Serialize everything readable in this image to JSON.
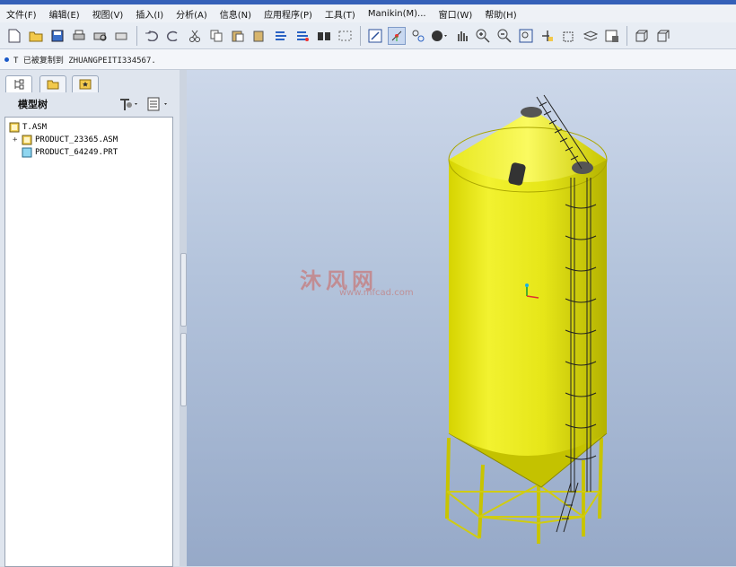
{
  "menu": [
    "文件(F)",
    "编辑(E)",
    "视图(V)",
    "插入(I)",
    "分析(A)",
    "信息(N)",
    "应用程序(P)",
    "工具(T)",
    "Manikin(M)...",
    "窗口(W)",
    "帮助(H)"
  ],
  "toolbar_icons": [
    "new-file",
    "open-folder",
    "save",
    "print",
    "print-preview",
    "send",
    "undo",
    "redo",
    "cut",
    "copy",
    "paste",
    "paste-special",
    "regenerate",
    "regenerate-manager",
    "find",
    "select-box",
    "repaint",
    "spin-center",
    "view-manager",
    "shading",
    "pan",
    "zoom-in",
    "zoom-out",
    "refit",
    "orient",
    "saved-views",
    "layers",
    "display-style",
    "wireframe",
    "hidden-line"
  ],
  "message": "T 已被复制到 ZHUANGPEITI334567.",
  "panel": {
    "title": "模型树",
    "tabs": [
      "model-tree",
      "folder-browser",
      "favorites"
    ]
  },
  "tree": {
    "root": "T.ASM",
    "items": [
      {
        "label": "PRODUCT_23365.ASM",
        "type": "asm",
        "expander": "+"
      },
      {
        "label": "PRODUCT_64249.PRT",
        "type": "prt",
        "expander": ""
      }
    ]
  },
  "watermark": {
    "text": "沐风网",
    "sub": "www.mfcad.com"
  },
  "colors": {
    "model": "#e8e810",
    "background_top": "#cdd8ea",
    "background_bottom": "#96a9c8",
    "accent": "#3560b8"
  }
}
